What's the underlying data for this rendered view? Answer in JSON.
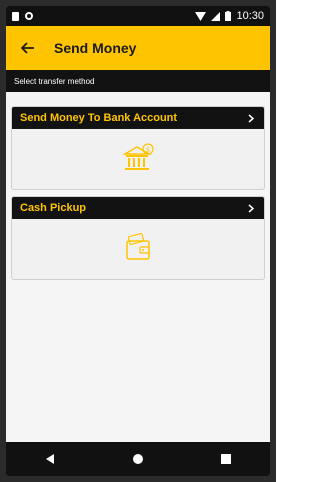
{
  "status_bar": {
    "time": "10:30",
    "icons": [
      "sim-card-icon",
      "notification-dot-icon",
      "wifi-icon",
      "signal-icon",
      "battery-icon"
    ]
  },
  "app_bar": {
    "title": "Send Money",
    "back_icon": "back-arrow-icon",
    "background": "#ffc400"
  },
  "subheader": {
    "text": "Select transfer method"
  },
  "methods": [
    {
      "label": "Send Money To Bank Account",
      "icon": "bank-money-icon"
    },
    {
      "label": "Cash Pickup",
      "icon": "wallet-cash-icon"
    }
  ],
  "colors": {
    "accent": "#ffc400",
    "header_dark": "#121212",
    "card_bg": "#f1f1f1"
  },
  "nav_bar": {
    "buttons": [
      "back-triangle-icon",
      "home-circle-icon",
      "recents-square-icon"
    ]
  }
}
